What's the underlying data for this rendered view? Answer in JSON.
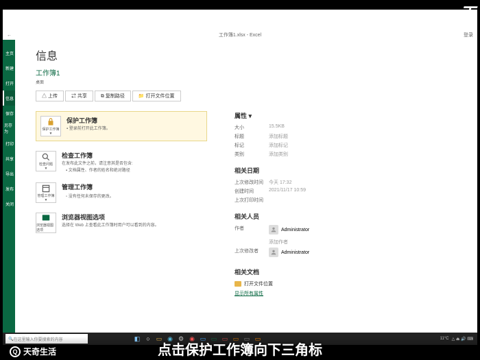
{
  "overlay": {
    "logo_text": "天",
    "watermark": "天奇生活",
    "caption": "点击保护工作簿向下三角标"
  },
  "titlebar": {
    "doc_title": "工作簿1.xlsx - Excel",
    "right": "登录"
  },
  "sidebar": {
    "items": [
      "主页",
      "新建",
      "打开",
      "信息",
      "保存",
      "另存为",
      "打印",
      "共享",
      "导出",
      "发布",
      "关闭"
    ]
  },
  "page": {
    "title": "信息",
    "doc_name": "工作簿1",
    "doc_path": "桌面"
  },
  "actions": {
    "upload": "△ 上传",
    "share": "⇄ 共享",
    "copypath": "⧉ 复制路径",
    "openloc": "📁 打开文件位置"
  },
  "cards": {
    "protect": {
      "icon_label": "保护工作簿",
      "title": "保护工作簿",
      "desc": "▪ 登录前打开此工作簿。"
    },
    "inspect": {
      "icon_label": "检查问题",
      "title": "检查工作簿",
      "desc": "在发布此文件之前，请注意其是否包含:",
      "bullet": "▪ 文档属性、作者的姓名和绝对路径"
    },
    "manage": {
      "icon_label": "管理工作簿",
      "title": "管理工作簿",
      "bullet": "▫ 没有任何未保存的更改。"
    },
    "browser": {
      "icon_label": "浏览器视图选项",
      "title": "浏览器视图选项",
      "desc": "选择在 Web 上查看此工作簿时用户可以看到的内容。"
    }
  },
  "props": {
    "header": "属性 ▾",
    "size_label": "大小",
    "size_value": "15.5KB",
    "title_label": "标题",
    "title_value": "添加标题",
    "tags_label": "标记",
    "tags_value": "添加标记",
    "cat_label": "类别",
    "cat_value": "添加类别",
    "dates_header": "相关日期",
    "modified_label": "上次修改时间",
    "modified_value": "今天 17:32",
    "created_label": "创建时间",
    "created_value": "2021/11/17 10:59",
    "printed_label": "上次打印时间",
    "printed_value": "",
    "people_header": "相关人员",
    "author_label": "作者",
    "author_value": "Administrator",
    "add_author": "添加作者",
    "lastmod_label": "上次修改者",
    "lastmod_value": "Administrator",
    "docs_header": "相关文档",
    "open_loc": "打开文件位置",
    "show_all": "显示所有属性"
  },
  "taskbar": {
    "search_placeholder": "在这里输入你要搜索的内容",
    "weather": "11°C"
  }
}
